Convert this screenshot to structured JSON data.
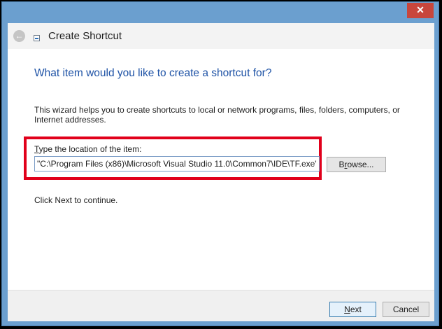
{
  "window": {
    "close_glyph": "✕",
    "header_title": "Create Shortcut",
    "back_glyph": "←"
  },
  "content": {
    "heading": "What item would you like to create a shortcut for?",
    "description": "This wizard helps you to create shortcuts to local or network programs, files, folders, computers, or Internet addresses.",
    "location_label_accel": "T",
    "location_label_rest": "ype the location of the item:",
    "location_value": "\"C:\\Program Files (x86)\\Microsoft Visual Studio 11.0\\Common7\\IDE\\TF.exe\"",
    "browse_accel": "r",
    "browse_pre": "B",
    "browse_post": "owse...",
    "continue_text": "Click Next to continue."
  },
  "footer": {
    "next_accel": "N",
    "next_rest": "ext",
    "cancel_label": "Cancel"
  },
  "colors": {
    "heading_blue": "#1f53a6",
    "highlight_red": "#e1001b",
    "frame_blue": "#6b9fcf",
    "close_red": "#c8463c"
  }
}
